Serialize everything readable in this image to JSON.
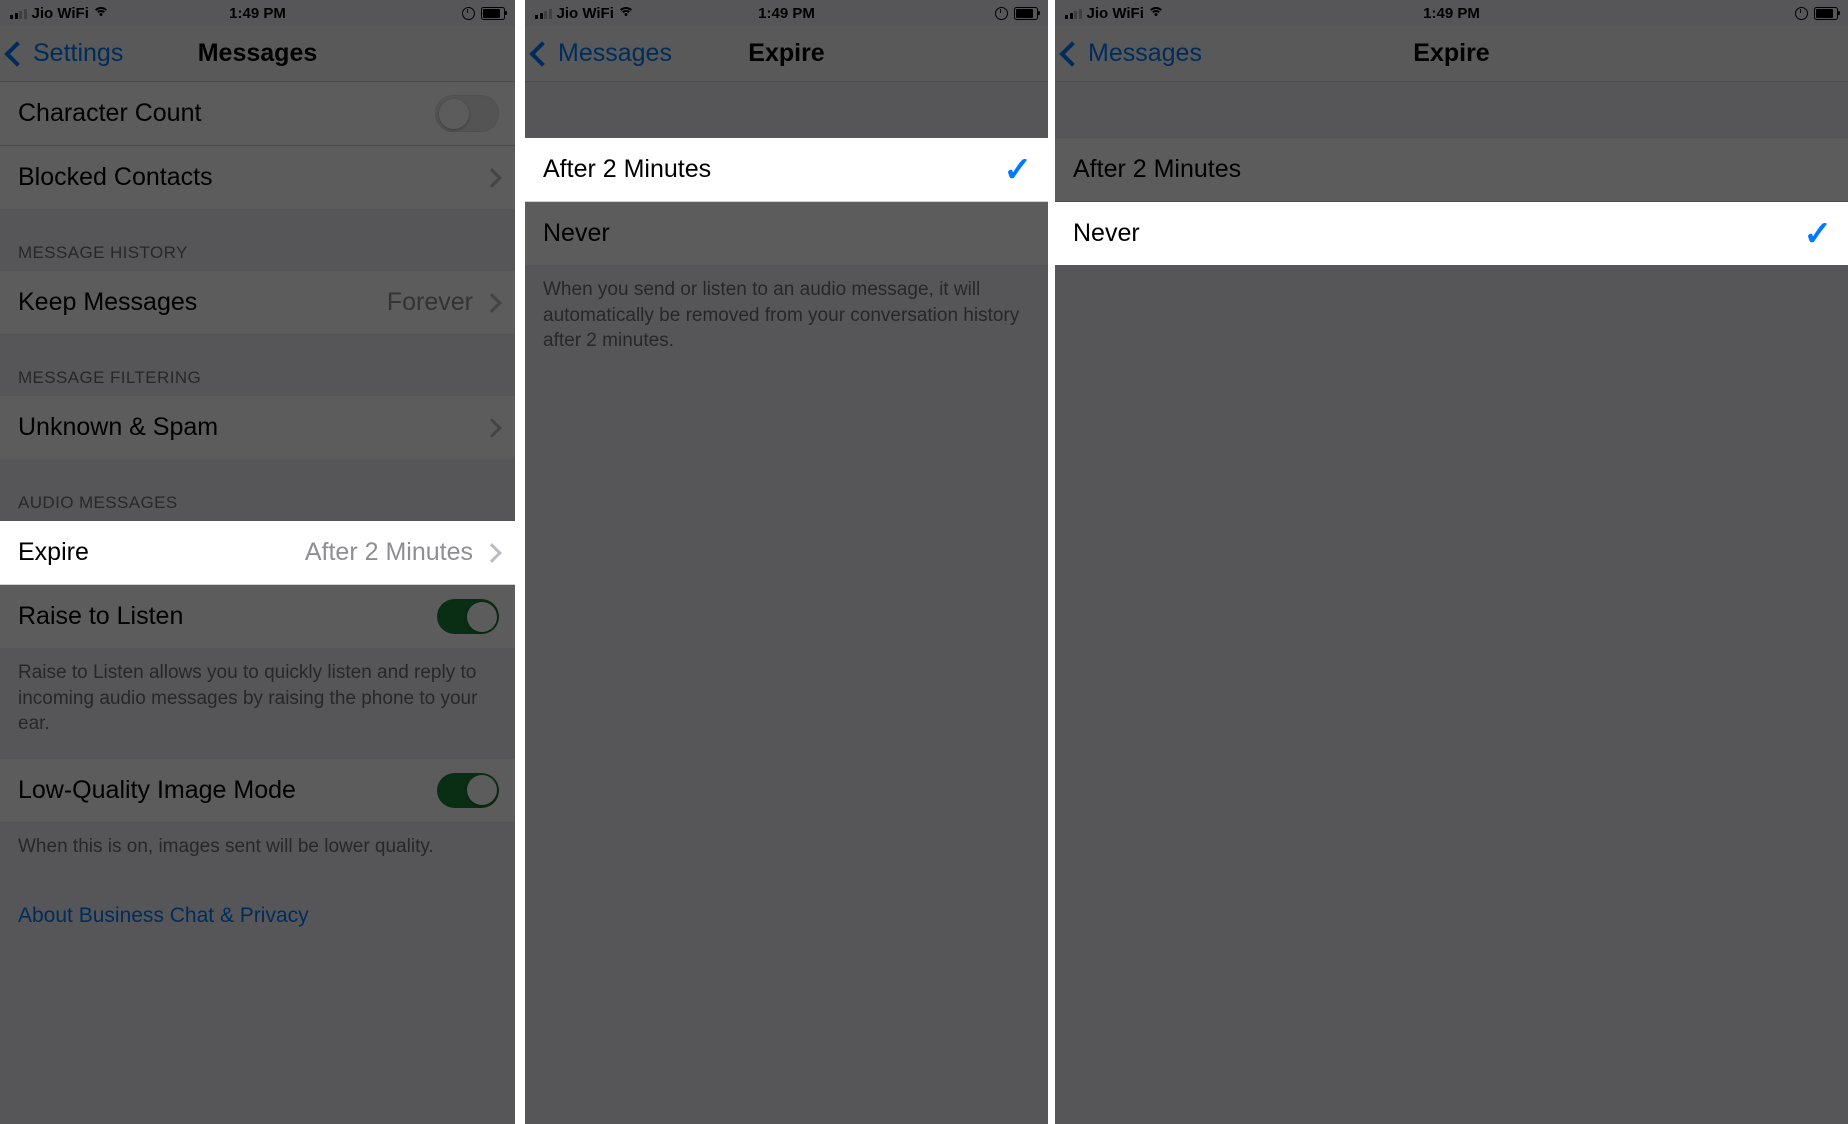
{
  "colors": {
    "accent_blue": "#007aff",
    "toggle_green": "#1a7f37",
    "table_bg": "#efeff4",
    "row_bg": "#ffffff",
    "secondary_text": "#8e8e93",
    "header_text": "#6d6d72"
  },
  "status_bar": {
    "carrier": "Jio WiFi",
    "time": "1:49 PM",
    "signal_icon": "signal-bars-icon",
    "wifi_icon": "wifi-icon",
    "alarm_icon": "alarm-clock-icon",
    "battery_icon": "battery-icon"
  },
  "panel1": {
    "nav": {
      "back_label": "Settings",
      "title": "Messages",
      "back_icon": "chevron-left-icon"
    },
    "rows": [
      {
        "label": "Character Count",
        "type": "toggle",
        "value": "off"
      },
      {
        "label": "Blocked Contacts",
        "type": "disclosure",
        "value": ""
      }
    ],
    "section_message_history": {
      "header": "MESSAGE HISTORY",
      "rows": [
        {
          "label": "Keep Messages",
          "value": "Forever",
          "type": "disclosure"
        }
      ]
    },
    "section_message_filtering": {
      "header": "MESSAGE FILTERING",
      "rows": [
        {
          "label": "Unknown & Spam",
          "value": "",
          "type": "disclosure"
        }
      ]
    },
    "section_audio_messages": {
      "header": "AUDIO MESSAGES",
      "expire": {
        "label": "Expire",
        "value": "After 2 Minutes",
        "type": "disclosure",
        "highlighted": true
      },
      "raise_to_listen": {
        "label": "Raise to Listen",
        "type": "toggle",
        "value": "on"
      },
      "raise_to_listen_note": "Raise to Listen allows you to quickly listen and reply to incoming audio messages by raising the phone to your ear.",
      "low_quality": {
        "label": "Low-Quality Image Mode",
        "type": "toggle",
        "value": "on"
      },
      "low_quality_note": "When this is on, images sent will be lower quality.",
      "business_chat_link": "About Business Chat & Privacy"
    }
  },
  "panel2": {
    "nav": {
      "back_label": "Messages",
      "title": "Expire",
      "back_icon": "chevron-left-icon"
    },
    "options": [
      {
        "label": "After 2 Minutes",
        "selected": true,
        "highlighted": true
      },
      {
        "label": "Never",
        "selected": false,
        "highlighted": false
      }
    ],
    "footnote": "When you send or listen to an audio message, it will automatically be removed from your conversation history after 2 minutes.",
    "check_icon": "checkmark-icon"
  },
  "panel3": {
    "nav": {
      "back_label": "Messages",
      "title": "Expire",
      "back_icon": "chevron-left-icon"
    },
    "options": [
      {
        "label": "After 2 Minutes",
        "selected": false,
        "highlighted": false
      },
      {
        "label": "Never",
        "selected": true,
        "highlighted": true
      }
    ],
    "check_icon": "checkmark-icon"
  }
}
